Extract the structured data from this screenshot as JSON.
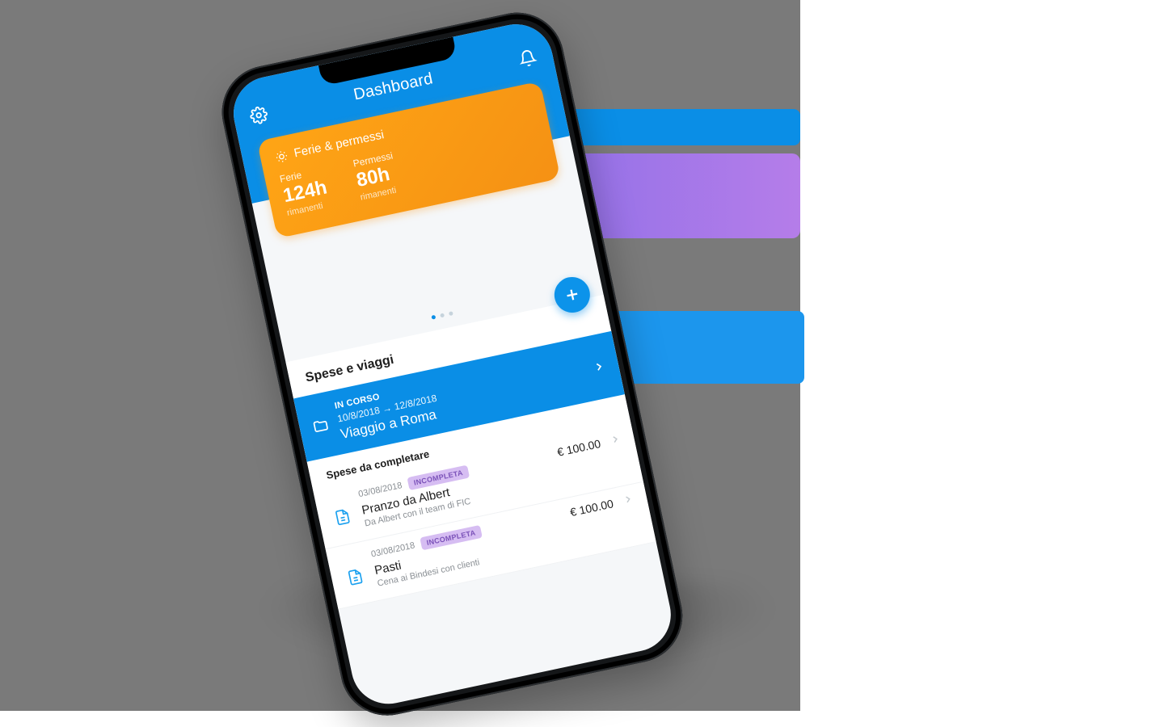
{
  "header": {
    "title": "Dashboard"
  },
  "ferie_card": {
    "title": "Ferie & permessi",
    "ferie_label": "Ferie",
    "ferie_value": "124h",
    "ferie_rim": "rimanenti",
    "permessi_label": "Permessi",
    "permessi_value": "80h",
    "permessi_rim": "rimanenti"
  },
  "spese": {
    "title": "Spese e viaggi",
    "in_corso": {
      "status": "IN CORSO",
      "date_from": "10/8/2018",
      "date_to": "12/8/2018",
      "arrow": "→",
      "name": "Viaggio a Roma"
    },
    "sub_header": "Spese da completare",
    "expenses": [
      {
        "date": "03/08/2018",
        "badge": "INCOMPLETA",
        "title": "Pranzo da Albert",
        "subtitle": "Da Albert con il team di FIC",
        "amount": "€ 100.00"
      },
      {
        "date": "03/08/2018",
        "badge": "INCOMPLETA",
        "title": "Pasti",
        "subtitle": "Cena ai Bindesi con clienti",
        "amount": "€ 100.00"
      }
    ]
  }
}
